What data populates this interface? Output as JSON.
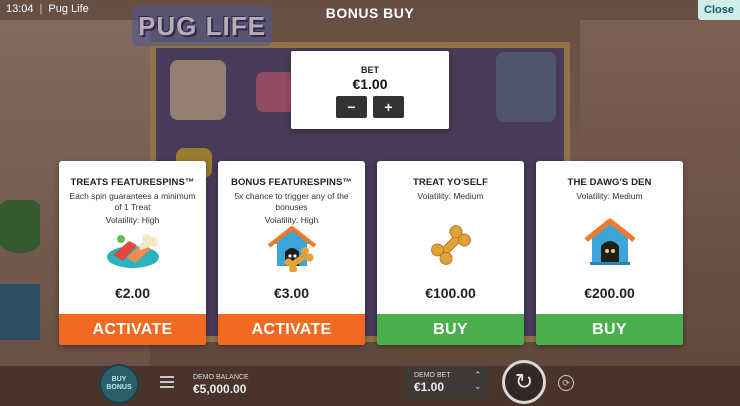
{
  "status_bar": {
    "time": "13:04",
    "game_name": "Pug Life"
  },
  "logo_text": "PUG LIFE",
  "header": {
    "title": "BONUS BUY",
    "close_label": "Close"
  },
  "bet": {
    "label": "BET",
    "value": "€1.00",
    "decrease_label": "−",
    "increase_label": "+"
  },
  "cards": [
    {
      "title": "TREATS FEATURESPINS™",
      "description": "Each spin guarantees a minimum of 1 Treat",
      "volatility": "Volatility: High",
      "icon": "treats-icon",
      "price": "€2.00",
      "action": "ACTIVATE",
      "action_color": "#f26a21"
    },
    {
      "title": "BONUS FEATURESPINS™",
      "description": "5x chance to trigger any of the bonuses",
      "volatility": "Volatility: High",
      "icon": "doghouse-bone-icon",
      "price": "€3.00",
      "action": "ACTIVATE",
      "action_color": "#f26a21"
    },
    {
      "title": "TREAT YO'SELF",
      "description": "",
      "volatility": "Volatility: Medium",
      "icon": "bone-icon",
      "price": "€100.00",
      "action": "BUY",
      "action_color": "#4caf4e"
    },
    {
      "title": "THE DAWG'S DEN",
      "description": "",
      "volatility": "Volatility: Medium",
      "icon": "doghouse-icon",
      "price": "€200.00",
      "action": "BUY",
      "action_color": "#4caf4e"
    }
  ],
  "bottom_bar": {
    "buy_bonus_label": "BUY BONUS",
    "demo_balance_label": "DEMO BALANCE",
    "demo_balance_value": "€5,000.00",
    "demo_bet_label": "DEMO BET",
    "demo_bet_value": "€1.00"
  }
}
